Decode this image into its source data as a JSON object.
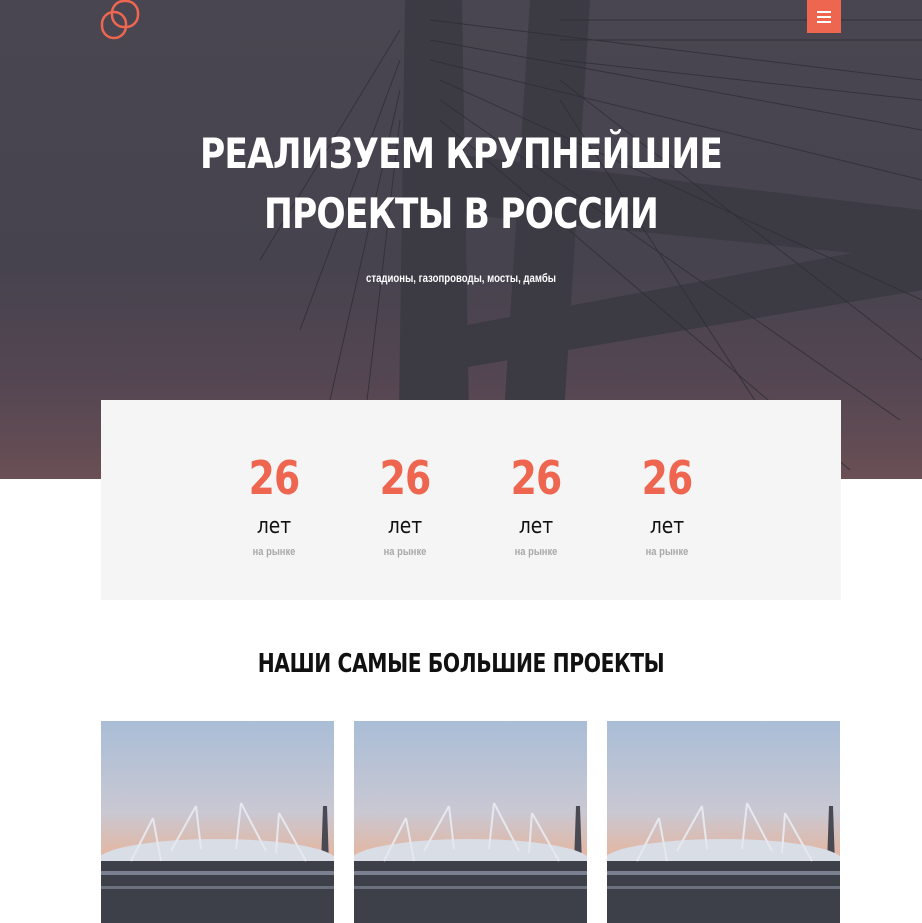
{
  "header": {
    "logo_icon": "linked-squares-logo",
    "menu_icon": "hamburger-icon",
    "accent_color": "#ee6650"
  },
  "hero": {
    "title_line1": "РЕАЛИЗУЕМ КРУПНЕЙШИЕ",
    "title_line2": "ПРОЕКТЫ В РОССИИ",
    "subtitle": "стадионы, газопроводы, мосты, дамбы"
  },
  "stats": [
    {
      "number": "26",
      "unit": "лет",
      "caption": "на рынке"
    },
    {
      "number": "26",
      "unit": "лет",
      "caption": "на рынке"
    },
    {
      "number": "26",
      "unit": "лет",
      "caption": "на рынке"
    },
    {
      "number": "26",
      "unit": "лет",
      "caption": "на рынке"
    }
  ],
  "projects": {
    "title": "НАШИ САМЫЕ БОЛЬШИЕ ПРОЕКТЫ",
    "items": [
      {
        "image": "stadium-at-sunset-photo"
      },
      {
        "image": "stadium-at-sunset-photo"
      },
      {
        "image": "stadium-at-sunset-photo"
      }
    ]
  }
}
